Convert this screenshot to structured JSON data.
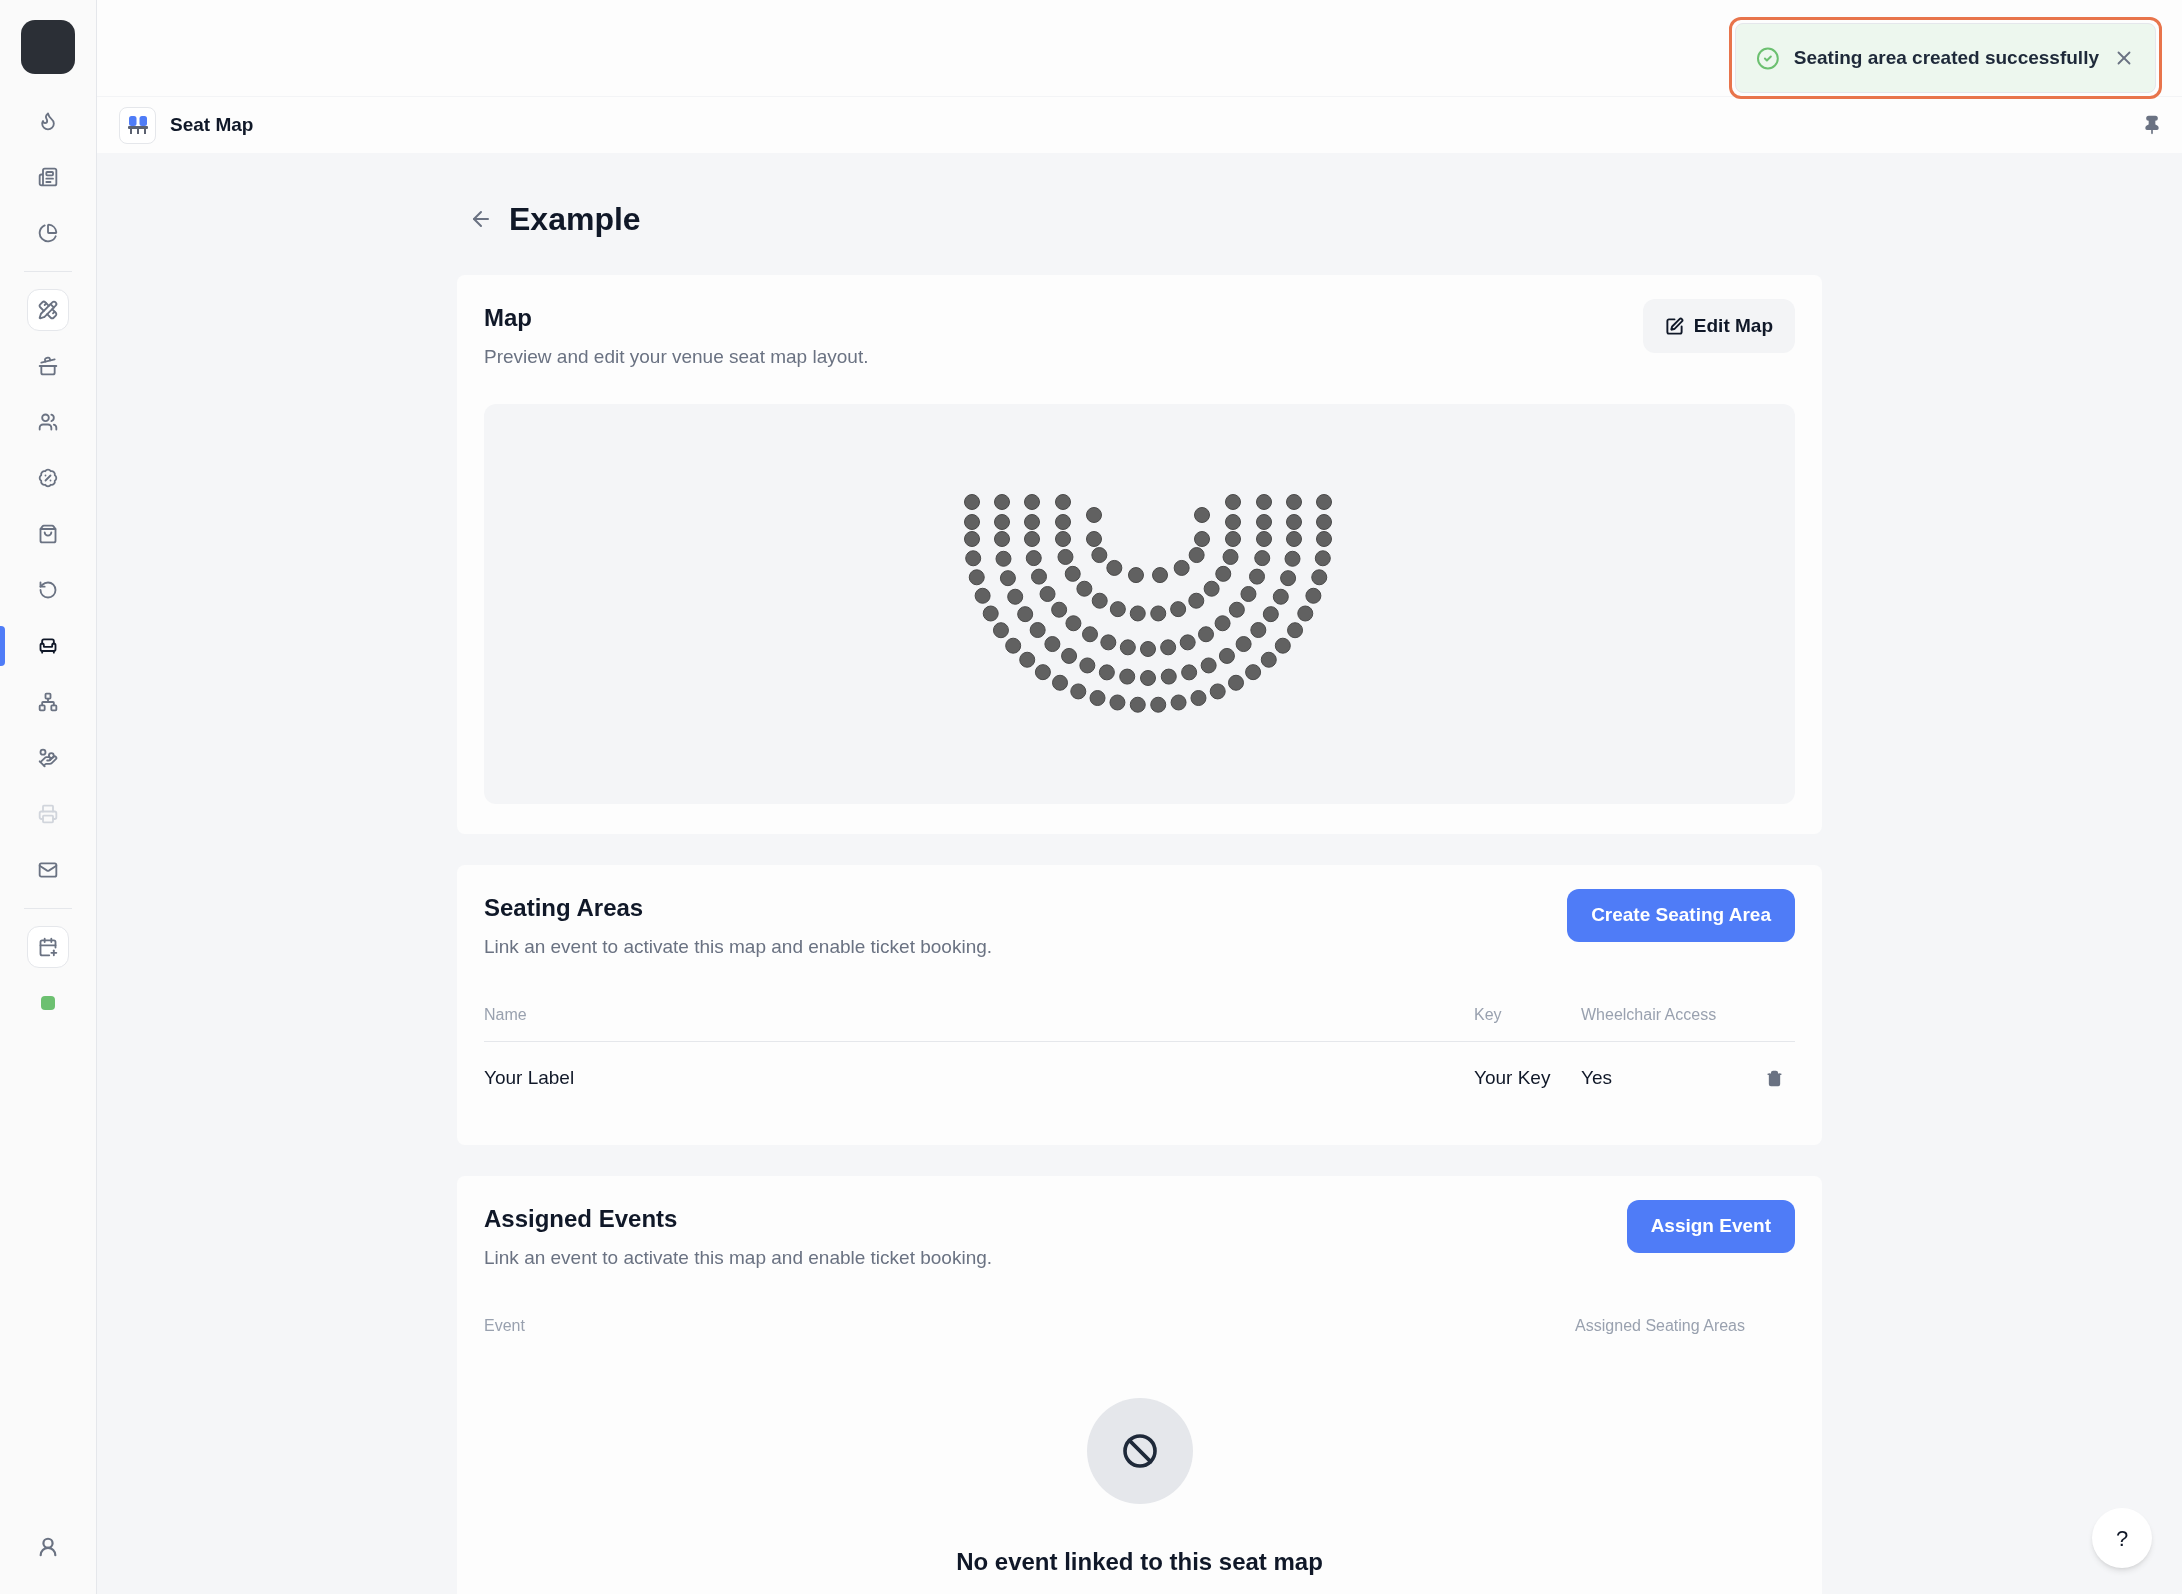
{
  "sidebar": {
    "items": [
      {
        "kind": "icon",
        "selected": false,
        "disabled": false
      },
      {
        "kind": "icon",
        "selected": false,
        "disabled": false
      },
      {
        "kind": "icon",
        "selected": false,
        "disabled": false
      },
      {
        "kind": "divider"
      },
      {
        "kind": "tile",
        "selected": false,
        "disabled": false
      },
      {
        "kind": "icon",
        "selected": false,
        "disabled": false
      },
      {
        "kind": "icon",
        "selected": false,
        "disabled": false
      },
      {
        "kind": "icon",
        "selected": false,
        "disabled": false
      },
      {
        "kind": "icon",
        "selected": false,
        "disabled": false
      },
      {
        "kind": "icon",
        "selected": false,
        "disabled": false
      },
      {
        "kind": "icon",
        "selected": true,
        "disabled": false
      },
      {
        "kind": "icon",
        "selected": false,
        "disabled": false
      },
      {
        "kind": "icon",
        "selected": false,
        "disabled": false
      },
      {
        "kind": "icon",
        "selected": false,
        "disabled": true
      },
      {
        "kind": "icon",
        "selected": false,
        "disabled": false
      },
      {
        "kind": "divider"
      },
      {
        "kind": "tile",
        "selected": false,
        "disabled": false
      },
      {
        "kind": "status",
        "color": "#6cc070"
      }
    ]
  },
  "toast": {
    "kind": "success",
    "message": "Seating area created successfully"
  },
  "header": {
    "title": "Seat Map"
  },
  "page": {
    "title": "Example"
  },
  "map_card": {
    "title": "Map",
    "description": "Preview and edit your venue seat map layout.",
    "button": "Edit Map"
  },
  "seating_areas": {
    "title": "Seating Areas",
    "description": "Link an event to activate this map and enable ticket booking.",
    "button": "Create Seating Area",
    "columns": [
      "Name",
      "Key",
      "Wheelchair Access"
    ],
    "rows": [
      {
        "cells": [
          "Your Label",
          "Your Key",
          "Yes"
        ]
      }
    ]
  },
  "assigned_events": {
    "title": "Assigned Events",
    "description": "Link an event to activate this map and enable ticket booking.",
    "button": "Assign Event",
    "columns": [
      "Event",
      "Assigned Seating Areas"
    ],
    "empty_message": "No event linked to this seat map"
  },
  "help_button": "?"
}
